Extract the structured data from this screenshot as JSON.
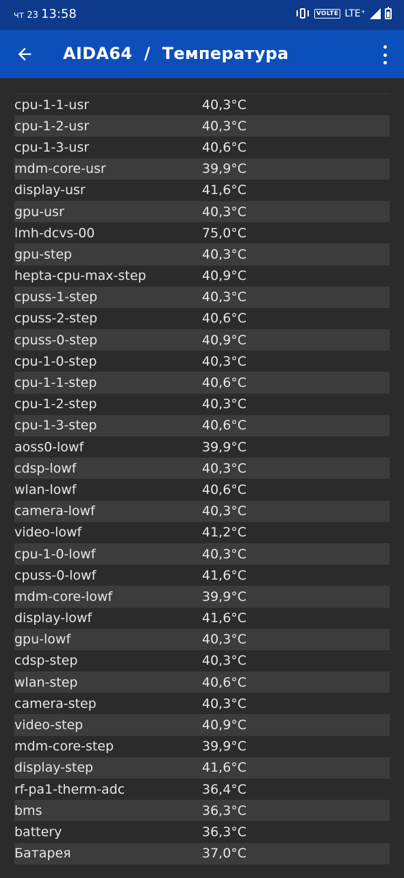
{
  "status_bar": {
    "day": "чт 23",
    "time": "13:58",
    "volte": "VOLTE",
    "network": "LTE⁺",
    "battery_level": 0.78
  },
  "app_bar": {
    "title": "AIDA64  /  Температура",
    "back_icon": "arrow-left-icon",
    "menu_icon": "more-vert-icon"
  },
  "sensors": [
    {
      "name": "cpu-1-1-usr",
      "value": "40,3°C"
    },
    {
      "name": "cpu-1-2-usr",
      "value": "40,3°C"
    },
    {
      "name": "cpu-1-3-usr",
      "value": "40,6°C"
    },
    {
      "name": "mdm-core-usr",
      "value": "39,9°C"
    },
    {
      "name": "display-usr",
      "value": "41,6°C"
    },
    {
      "name": "gpu-usr",
      "value": "40,3°C"
    },
    {
      "name": "lmh-dcvs-00",
      "value": "75,0°C"
    },
    {
      "name": "gpu-step",
      "value": "40,3°C"
    },
    {
      "name": "hepta-cpu-max-step",
      "value": "40,9°C"
    },
    {
      "name": "cpuss-1-step",
      "value": "40,3°C"
    },
    {
      "name": "cpuss-2-step",
      "value": "40,6°C"
    },
    {
      "name": "cpuss-0-step",
      "value": "40,9°C"
    },
    {
      "name": "cpu-1-0-step",
      "value": "40,3°C"
    },
    {
      "name": "cpu-1-1-step",
      "value": "40,6°C"
    },
    {
      "name": "cpu-1-2-step",
      "value": "40,3°C"
    },
    {
      "name": "cpu-1-3-step",
      "value": "40,6°C"
    },
    {
      "name": "aoss0-lowf",
      "value": "39,9°C"
    },
    {
      "name": "cdsp-lowf",
      "value": "40,3°C"
    },
    {
      "name": "wlan-lowf",
      "value": "40,6°C"
    },
    {
      "name": "camera-lowf",
      "value": "40,3°C"
    },
    {
      "name": "video-lowf",
      "value": "41,2°C"
    },
    {
      "name": "cpu-1-0-lowf",
      "value": "40,3°C"
    },
    {
      "name": "cpuss-0-lowf",
      "value": "41,6°C"
    },
    {
      "name": "mdm-core-lowf",
      "value": "39,9°C"
    },
    {
      "name": "display-lowf",
      "value": "41,6°C"
    },
    {
      "name": "gpu-lowf",
      "value": "40,3°C"
    },
    {
      "name": "cdsp-step",
      "value": "40,3°C"
    },
    {
      "name": "wlan-step",
      "value": "40,6°C"
    },
    {
      "name": "camera-step",
      "value": "40,3°C"
    },
    {
      "name": "video-step",
      "value": "40,9°C"
    },
    {
      "name": "mdm-core-step",
      "value": "39,9°C"
    },
    {
      "name": "display-step",
      "value": "41,6°C"
    },
    {
      "name": "rf-pa1-therm-adc",
      "value": "36,4°C"
    },
    {
      "name": "bms",
      "value": "36,3°C"
    },
    {
      "name": "battery",
      "value": "36,3°C"
    },
    {
      "name": "Батарея",
      "value": "37,0°C"
    }
  ],
  "colors": {
    "status_bar": "#0d3a8a",
    "app_bar": "#0d4fba",
    "background": "#2b2b2b",
    "row_alt": "#3c3c3c",
    "text": "#e6e6e6"
  }
}
